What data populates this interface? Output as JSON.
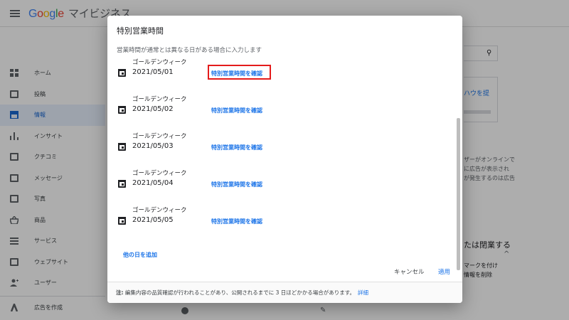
{
  "app": {
    "brand": "Google",
    "product": "マイビジネス"
  },
  "sidebar": {
    "items": [
      {
        "label": "ホーム",
        "icon": "grid-icon"
      },
      {
        "label": "投稿",
        "icon": "post-icon"
      },
      {
        "label": "情報",
        "icon": "store-icon",
        "active": true
      },
      {
        "label": "インサイト",
        "icon": "bar-chart-icon"
      },
      {
        "label": "クチコミ",
        "icon": "review-icon"
      },
      {
        "label": "メッセージ",
        "icon": "message-icon"
      },
      {
        "label": "写真",
        "icon": "photo-icon"
      },
      {
        "label": "商品",
        "icon": "basket-icon"
      },
      {
        "label": "サービス",
        "icon": "list-icon"
      },
      {
        "label": "ウェブサイト",
        "icon": "website-icon"
      },
      {
        "label": "ユーザー",
        "icon": "add-user-icon"
      }
    ],
    "ads_label": "広告を作成"
  },
  "background_right": {
    "link_fragment": "ハウを提",
    "desc_lines": [
      "ザーがオンラインで",
      "に広告が表示され",
      "が発生するのは広告"
    ],
    "close_fragment": "たは閉業する",
    "mark_lines": [
      "マークを付け",
      "情報を削除"
    ]
  },
  "dialog": {
    "title": "特別営業時間",
    "subtitle": "営業時間が通常とは異なる日がある場合に入力します",
    "entries": [
      {
        "name": "ゴールデンウィーク",
        "date": "2021/05/01",
        "link": "特別営業時間を確認"
      },
      {
        "name": "ゴールデンウィーク",
        "date": "2021/05/02",
        "link": "特別営業時間を確認"
      },
      {
        "name": "ゴールデンウィーク",
        "date": "2021/05/03",
        "link": "特別営業時間を確認"
      },
      {
        "name": "ゴールデンウィーク",
        "date": "2021/05/04",
        "link": "特別営業時間を確認"
      },
      {
        "name": "ゴールデンウィーク",
        "date": "2021/05/05",
        "link": "特別営業時間を確認"
      }
    ],
    "add_day": "他の日を追加",
    "cancel": "キャンセル",
    "apply": "適用",
    "note_prefix": "注:",
    "note_text": " 編集内容の品質確認が行われることがあり、公開されるまでに 3 日ほどかかる場合があります。",
    "note_link": "詳細"
  },
  "colors": {
    "accent": "#1a73e8",
    "highlight": "#e41b1b",
    "active_nav_bg": "#e8f0fe",
    "scrim": "rgba(0,0,0,0.32)"
  }
}
